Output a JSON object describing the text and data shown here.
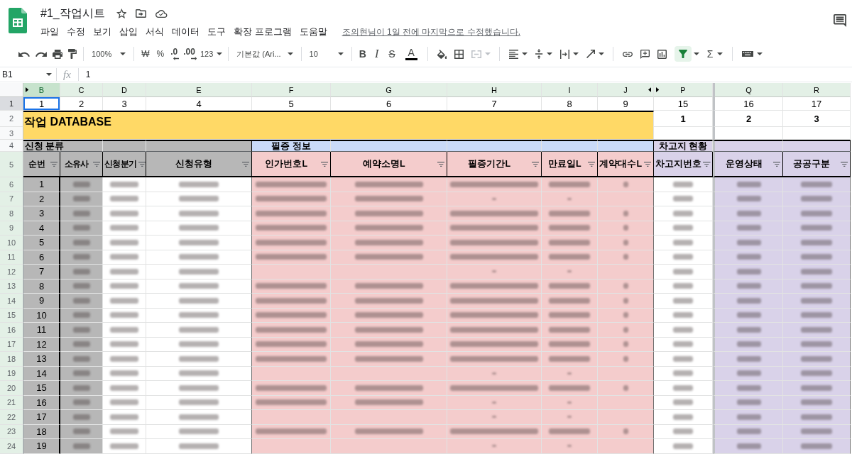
{
  "document": {
    "title": "#1_작업시트",
    "menus": [
      "파일",
      "수정",
      "보기",
      "삽입",
      "서식",
      "데이터",
      "도구",
      "확장 프로그램",
      "도움말"
    ],
    "last_edit": "조의현님이 1일 전에 마지막으로 수정했습니다."
  },
  "toolbar": {
    "zoom": "100%",
    "currency": "₩",
    "percent": "%",
    "decimals_decrease": ".0",
    "decimals_increase": ".00",
    "number_format": "123",
    "font": "기본값 (Ari...",
    "font_size": "10",
    "bold": "B",
    "italic": "I",
    "strikethrough": "S",
    "text_color": "A",
    "merge_disabled": true,
    "filter_active": true,
    "functions": "Σ"
  },
  "formula_bar": {
    "cell_ref": "B1",
    "fx": "fx",
    "value": "1"
  },
  "sheet": {
    "title_band": "작업 DATABASE",
    "header_rows": [
      {
        "number": "1",
        "selected": true,
        "in_filter": false
      },
      {
        "number": "2",
        "selected": false,
        "in_filter": false
      },
      {
        "number": "3",
        "selected": false,
        "in_filter": false
      },
      {
        "number": "4",
        "selected": false,
        "in_filter": false
      },
      {
        "number": "5",
        "selected": false,
        "in_filter": true
      }
    ],
    "groups": [
      {
        "label": "신청 분류",
        "color": "#b7b7b7",
        "columns": [
          {
            "letter": "B",
            "selected": true,
            "hidden_before": true,
            "row_1": "1",
            "header": "순번",
            "filter": true,
            "color": "#b7b7b7",
            "shaded": true
          },
          {
            "letter": "C",
            "selected": false,
            "hidden_before": false,
            "row_1": "2",
            "header": "소유사",
            "filter": true,
            "color": "#b7b7b7",
            "shaded": true
          },
          {
            "letter": "D",
            "selected": false,
            "hidden_before": false,
            "row_1": "3",
            "header": "신청분기",
            "filter": true,
            "color": "#b7b7b7",
            "shaded": false
          },
          {
            "letter": "E",
            "selected": false,
            "hidden_before": false,
            "row_1": "4",
            "header": "신청유형",
            "filter": true,
            "color": "#b7b7b7",
            "shaded": false
          }
        ]
      },
      {
        "label": "필증 정보",
        "color": "#c9daf8",
        "columns": [
          {
            "letter": "F",
            "selected": false,
            "hidden_before": false,
            "row_1": "5",
            "header": "인가번호L",
            "filter": true,
            "color": "#f4cccc",
            "shaded": true
          },
          {
            "letter": "G",
            "selected": false,
            "hidden_before": false,
            "row_1": "6",
            "header": "예약소명L",
            "filter": true,
            "color": "#f4cccc",
            "shaded": true
          },
          {
            "letter": "H",
            "selected": false,
            "hidden_before": false,
            "row_1": "7",
            "header": "필증기간L",
            "filter": true,
            "color": "#f4cccc",
            "shaded": true
          },
          {
            "letter": "I",
            "selected": false,
            "hidden_before": false,
            "row_1": "8",
            "header": "만료일L",
            "filter": true,
            "color": "#f4cccc",
            "shaded": true
          },
          {
            "letter": "J",
            "selected": false,
            "hidden_before": false,
            "row_1": "9",
            "header": "계약대수L",
            "filter": true,
            "color": "#f4cccc",
            "shaded": true
          }
        ]
      },
      {
        "label": "차고지 현황",
        "color": "#d9d2e9",
        "columns": [
          {
            "letter": "P",
            "selected": false,
            "hidden_before": true,
            "row_1": "15",
            "row_2": "1",
            "header": "차고지번호",
            "filter": true,
            "color": "#d9d2e9",
            "shaded": false
          },
          {
            "letter": "Q",
            "selected": false,
            "hidden_before": false,
            "divider_before": true,
            "row_1": "16",
            "row_2": "2",
            "header": "운영상태",
            "filter": true,
            "color": "#d9d2e9",
            "shaded": true
          },
          {
            "letter": "R",
            "selected": false,
            "hidden_before": false,
            "row_1": "17",
            "row_2": "3",
            "header": "공공구분",
            "filter": true,
            "color": "#d9d2e9",
            "shaded": true
          }
        ]
      }
    ],
    "rows": [
      {
        "number": "6",
        "in_filter": true,
        "cells": [
          {
            "kind": "number",
            "text": "1"
          },
          {
            "kind": "blurred"
          },
          {
            "kind": "blurred"
          },
          {
            "kind": "blurred"
          },
          {
            "kind": "blurred"
          },
          {
            "kind": "blurred"
          },
          {
            "kind": "blurred"
          },
          {
            "kind": "blurred"
          },
          {
            "kind": "blurred"
          },
          {
            "kind": "blurred"
          },
          {
            "kind": "blurred"
          },
          {
            "kind": "blurred"
          }
        ]
      },
      {
        "number": "7",
        "in_filter": true,
        "cells": [
          {
            "kind": "number",
            "text": "2"
          },
          {
            "kind": "blurred"
          },
          {
            "kind": "blurred"
          },
          {
            "kind": "blurred"
          },
          {
            "kind": "blurred"
          },
          {
            "kind": "blurred"
          },
          {
            "kind": "dash"
          },
          {
            "kind": "dash"
          },
          {
            "kind": "empty"
          },
          {
            "kind": "blurred"
          },
          {
            "kind": "blurred"
          },
          {
            "kind": "blurred"
          }
        ]
      },
      {
        "number": "8",
        "in_filter": true,
        "cells": [
          {
            "kind": "number",
            "text": "3"
          },
          {
            "kind": "blurred"
          },
          {
            "kind": "blurred"
          },
          {
            "kind": "blurred"
          },
          {
            "kind": "blurred"
          },
          {
            "kind": "blurred"
          },
          {
            "kind": "blurred"
          },
          {
            "kind": "blurred"
          },
          {
            "kind": "blurred"
          },
          {
            "kind": "blurred"
          },
          {
            "kind": "blurred"
          },
          {
            "kind": "blurred"
          }
        ]
      },
      {
        "number": "9",
        "in_filter": true,
        "cells": [
          {
            "kind": "number",
            "text": "4"
          },
          {
            "kind": "blurred"
          },
          {
            "kind": "blurred"
          },
          {
            "kind": "blurred"
          },
          {
            "kind": "blurred"
          },
          {
            "kind": "blurred"
          },
          {
            "kind": "blurred"
          },
          {
            "kind": "blurred"
          },
          {
            "kind": "blurred"
          },
          {
            "kind": "blurred"
          },
          {
            "kind": "blurred"
          },
          {
            "kind": "blurred"
          }
        ]
      },
      {
        "number": "10",
        "in_filter": true,
        "cells": [
          {
            "kind": "number",
            "text": "5"
          },
          {
            "kind": "blurred"
          },
          {
            "kind": "blurred"
          },
          {
            "kind": "blurred"
          },
          {
            "kind": "blurred"
          },
          {
            "kind": "blurred"
          },
          {
            "kind": "blurred"
          },
          {
            "kind": "blurred"
          },
          {
            "kind": "blurred"
          },
          {
            "kind": "blurred"
          },
          {
            "kind": "blurred"
          },
          {
            "kind": "blurred"
          }
        ]
      },
      {
        "number": "11",
        "in_filter": true,
        "cells": [
          {
            "kind": "number",
            "text": "6"
          },
          {
            "kind": "blurred"
          },
          {
            "kind": "blurred"
          },
          {
            "kind": "blurred"
          },
          {
            "kind": "blurred"
          },
          {
            "kind": "blurred"
          },
          {
            "kind": "blurred"
          },
          {
            "kind": "blurred"
          },
          {
            "kind": "blurred"
          },
          {
            "kind": "blurred"
          },
          {
            "kind": "blurred"
          },
          {
            "kind": "blurred"
          }
        ]
      },
      {
        "number": "12",
        "in_filter": true,
        "cells": [
          {
            "kind": "number",
            "text": "7"
          },
          {
            "kind": "blurred"
          },
          {
            "kind": "blurred"
          },
          {
            "kind": "blurred"
          },
          {
            "kind": "empty"
          },
          {
            "kind": "empty"
          },
          {
            "kind": "dash"
          },
          {
            "kind": "dash"
          },
          {
            "kind": "empty"
          },
          {
            "kind": "blurred"
          },
          {
            "kind": "blurred"
          },
          {
            "kind": "blurred"
          }
        ]
      },
      {
        "number": "13",
        "in_filter": true,
        "cells": [
          {
            "kind": "number",
            "text": "8"
          },
          {
            "kind": "blurred"
          },
          {
            "kind": "blurred"
          },
          {
            "kind": "blurred"
          },
          {
            "kind": "blurred"
          },
          {
            "kind": "blurred"
          },
          {
            "kind": "blurred"
          },
          {
            "kind": "blurred"
          },
          {
            "kind": "blurred"
          },
          {
            "kind": "blurred"
          },
          {
            "kind": "blurred"
          },
          {
            "kind": "blurred"
          }
        ]
      },
      {
        "number": "14",
        "in_filter": true,
        "cells": [
          {
            "kind": "number",
            "text": "9"
          },
          {
            "kind": "blurred"
          },
          {
            "kind": "blurred"
          },
          {
            "kind": "blurred"
          },
          {
            "kind": "blurred"
          },
          {
            "kind": "blurred"
          },
          {
            "kind": "blurred"
          },
          {
            "kind": "blurred"
          },
          {
            "kind": "blurred"
          },
          {
            "kind": "blurred"
          },
          {
            "kind": "blurred"
          },
          {
            "kind": "blurred"
          }
        ]
      },
      {
        "number": "15",
        "in_filter": true,
        "cells": [
          {
            "kind": "number",
            "text": "10"
          },
          {
            "kind": "blurred"
          },
          {
            "kind": "blurred"
          },
          {
            "kind": "blurred"
          },
          {
            "kind": "blurred"
          },
          {
            "kind": "blurred"
          },
          {
            "kind": "blurred"
          },
          {
            "kind": "blurred"
          },
          {
            "kind": "blurred"
          },
          {
            "kind": "blurred"
          },
          {
            "kind": "blurred"
          },
          {
            "kind": "blurred"
          }
        ]
      },
      {
        "number": "16",
        "in_filter": true,
        "cells": [
          {
            "kind": "number",
            "text": "11"
          },
          {
            "kind": "blurred"
          },
          {
            "kind": "blurred"
          },
          {
            "kind": "blurred"
          },
          {
            "kind": "blurred"
          },
          {
            "kind": "blurred"
          },
          {
            "kind": "blurred"
          },
          {
            "kind": "blurred"
          },
          {
            "kind": "blurred"
          },
          {
            "kind": "blurred"
          },
          {
            "kind": "blurred"
          },
          {
            "kind": "blurred"
          }
        ]
      },
      {
        "number": "17",
        "in_filter": true,
        "cells": [
          {
            "kind": "number",
            "text": "12"
          },
          {
            "kind": "blurred"
          },
          {
            "kind": "blurred"
          },
          {
            "kind": "blurred"
          },
          {
            "kind": "blurred"
          },
          {
            "kind": "blurred"
          },
          {
            "kind": "blurred"
          },
          {
            "kind": "blurred"
          },
          {
            "kind": "blurred"
          },
          {
            "kind": "blurred"
          },
          {
            "kind": "blurred"
          },
          {
            "kind": "blurred"
          }
        ]
      },
      {
        "number": "18",
        "in_filter": true,
        "cells": [
          {
            "kind": "number",
            "text": "13"
          },
          {
            "kind": "blurred"
          },
          {
            "kind": "blurred"
          },
          {
            "kind": "blurred"
          },
          {
            "kind": "blurred"
          },
          {
            "kind": "blurred"
          },
          {
            "kind": "blurred"
          },
          {
            "kind": "blurred"
          },
          {
            "kind": "blurred"
          },
          {
            "kind": "blurred"
          },
          {
            "kind": "blurred"
          },
          {
            "kind": "blurred"
          }
        ]
      },
      {
        "number": "19",
        "in_filter": true,
        "cells": [
          {
            "kind": "number",
            "text": "14"
          },
          {
            "kind": "blurred"
          },
          {
            "kind": "blurred"
          },
          {
            "kind": "blurred"
          },
          {
            "kind": "empty"
          },
          {
            "kind": "empty"
          },
          {
            "kind": "dash"
          },
          {
            "kind": "dash"
          },
          {
            "kind": "empty"
          },
          {
            "kind": "blurred"
          },
          {
            "kind": "blurred"
          },
          {
            "kind": "blurred"
          }
        ]
      },
      {
        "number": "20",
        "in_filter": true,
        "cells": [
          {
            "kind": "number",
            "text": "15"
          },
          {
            "kind": "blurred"
          },
          {
            "kind": "blurred"
          },
          {
            "kind": "blurred"
          },
          {
            "kind": "blurred"
          },
          {
            "kind": "blurred"
          },
          {
            "kind": "blurred"
          },
          {
            "kind": "blurred"
          },
          {
            "kind": "blurred"
          },
          {
            "kind": "blurred"
          },
          {
            "kind": "blurred"
          },
          {
            "kind": "blurred"
          }
        ]
      },
      {
        "number": "21",
        "in_filter": true,
        "cells": [
          {
            "kind": "number",
            "text": "16"
          },
          {
            "kind": "blurred"
          },
          {
            "kind": "blurred"
          },
          {
            "kind": "blurred"
          },
          {
            "kind": "blurred"
          },
          {
            "kind": "blurred"
          },
          {
            "kind": "dash"
          },
          {
            "kind": "dash"
          },
          {
            "kind": "empty"
          },
          {
            "kind": "blurred"
          },
          {
            "kind": "blurred"
          },
          {
            "kind": "blurred"
          }
        ]
      },
      {
        "number": "22",
        "in_filter": true,
        "cells": [
          {
            "kind": "number",
            "text": "17"
          },
          {
            "kind": "blurred"
          },
          {
            "kind": "blurred"
          },
          {
            "kind": "blurred"
          },
          {
            "kind": "empty"
          },
          {
            "kind": "empty"
          },
          {
            "kind": "dash"
          },
          {
            "kind": "dash"
          },
          {
            "kind": "empty"
          },
          {
            "kind": "blurred"
          },
          {
            "kind": "blurred"
          },
          {
            "kind": "blurred"
          }
        ]
      },
      {
        "number": "23",
        "in_filter": true,
        "cells": [
          {
            "kind": "number",
            "text": "18"
          },
          {
            "kind": "blurred"
          },
          {
            "kind": "blurred"
          },
          {
            "kind": "blurred"
          },
          {
            "kind": "blurred"
          },
          {
            "kind": "blurred"
          },
          {
            "kind": "blurred"
          },
          {
            "kind": "blurred"
          },
          {
            "kind": "blurred"
          },
          {
            "kind": "blurred"
          },
          {
            "kind": "blurred"
          },
          {
            "kind": "blurred"
          }
        ]
      },
      {
        "number": "24",
        "in_filter": true,
        "cells": [
          {
            "kind": "number",
            "text": "19"
          },
          {
            "kind": "blurred"
          },
          {
            "kind": "blurred"
          },
          {
            "kind": "blurred"
          },
          {
            "kind": "empty"
          },
          {
            "kind": "empty"
          },
          {
            "kind": "dash"
          },
          {
            "kind": "dash"
          },
          {
            "kind": "empty"
          },
          {
            "kind": "blurred"
          },
          {
            "kind": "blurred"
          },
          {
            "kind": "blurred"
          }
        ]
      }
    ]
  }
}
